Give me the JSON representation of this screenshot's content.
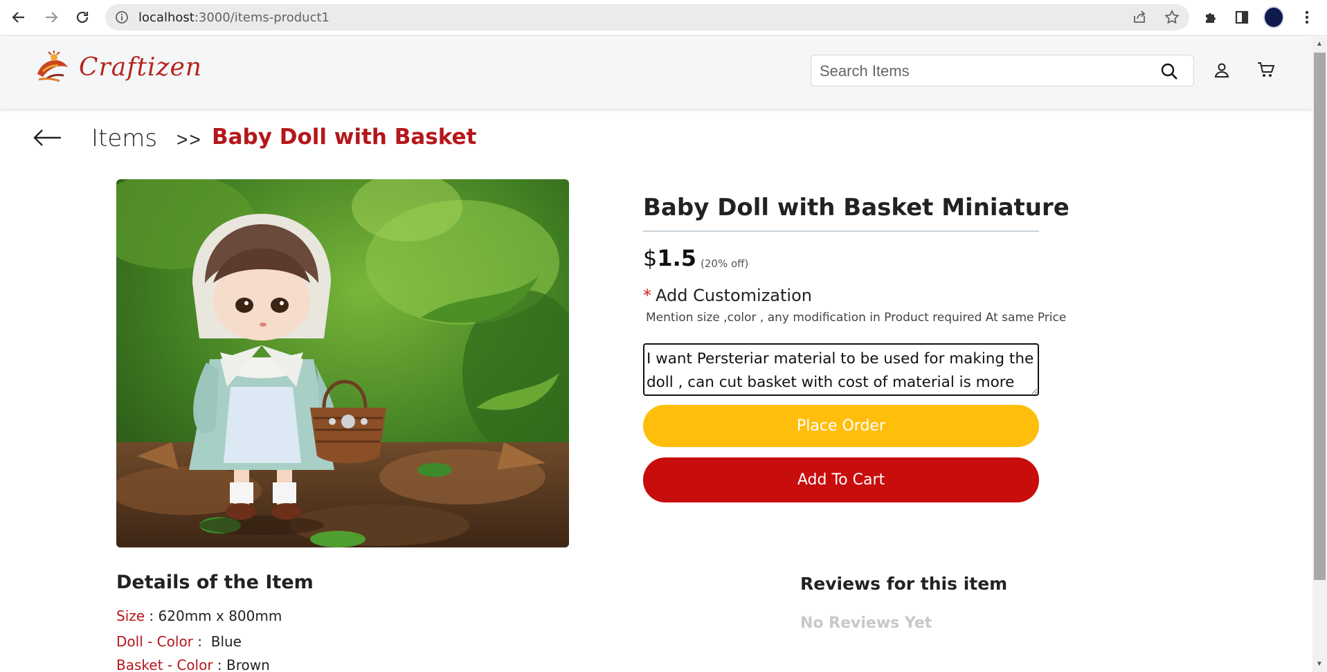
{
  "browser": {
    "url_host": "localhost",
    "url_path": ":3000/items-product1"
  },
  "site": {
    "logo_text": "Craftizen",
    "search_placeholder": "Search Items"
  },
  "breadcrumb": {
    "parent": "Items",
    "separator": ">>",
    "current": "Baby Doll with Basket"
  },
  "product": {
    "title": "Baby Doll with Basket Miniature",
    "price_currency": "$",
    "price_amount": "1.5",
    "discount": "(20% off)",
    "customization_required_mark": "*",
    "customization_label": "Add Customization",
    "customization_hint": "Mention size ,color , any modification in Product required At same Price",
    "customization_value": "I want Persteriar material to be used for making the doll , can cut basket with cost of material is more",
    "place_order_label": "Place Order",
    "add_to_cart_label": "Add To Cart"
  },
  "details": {
    "title": "Details of the Item",
    "rows": [
      {
        "key": "Size",
        "sep": " : ",
        "value": "620mm x 800mm"
      },
      {
        "key": "Doll - Color",
        "sep": " :  ",
        "value": "Blue"
      },
      {
        "key": "Basket - Color",
        "sep": " : ",
        "value": "Brown"
      }
    ]
  },
  "reviews": {
    "title": "Reviews for this item",
    "empty_text": "No Reviews Yet"
  },
  "colors": {
    "brand_red": "#b5161b",
    "order_yellow": "#ffbe0b",
    "cart_red": "#c80d0d"
  }
}
